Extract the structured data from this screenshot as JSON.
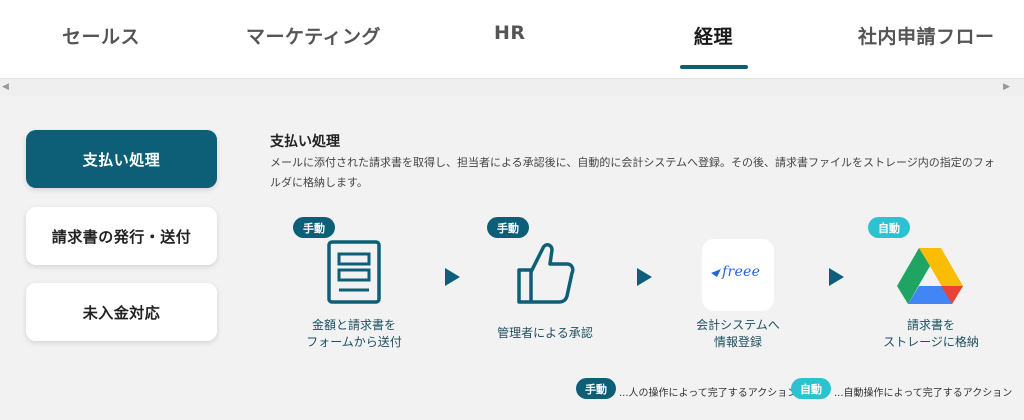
{
  "tabs": [
    {
      "label": "セールス"
    },
    {
      "label": "マーケティング"
    },
    {
      "label": "HR"
    },
    {
      "label": "経理"
    },
    {
      "label": "社内申請フロー"
    }
  ],
  "sidebar": {
    "items": [
      {
        "label": "支払い処理"
      },
      {
        "label": "請求書の発行・送付"
      },
      {
        "label": "未入金対応"
      }
    ]
  },
  "main": {
    "title": "支払い処理",
    "description": "メールに添付された請求書を取得し、担当者による承認後に、自動的に会計システムへ登録。その後、請求書ファイルをストレージ内の指定のフォルダに格納します。",
    "steps": [
      {
        "badge": "手動",
        "label_line1": "金額と請求書を",
        "label_line2": "フォームから送付",
        "icon": "form-document-icon"
      },
      {
        "badge": "手動",
        "label_line1": "管理者による承認",
        "label_line2": "",
        "icon": "thumbs-up-icon"
      },
      {
        "badge": "",
        "label_line1": "会計システムへ",
        "label_line2": "情報登録",
        "icon": "freee-logo"
      },
      {
        "badge": "自動",
        "label_line1": "請求書を",
        "label_line2": "ストレージに格納",
        "icon": "google-drive-icon"
      }
    ],
    "freee_logo_text": "freee",
    "legend": {
      "manual_badge": "手動",
      "manual_text": "...人の操作によって完了するアクション",
      "auto_badge": "自動",
      "auto_text": "...自動操作によって完了するアクション"
    }
  },
  "colors": {
    "accent": "#0d5f78",
    "auto": "#2cc2cf",
    "background": "#f2f2f2"
  }
}
